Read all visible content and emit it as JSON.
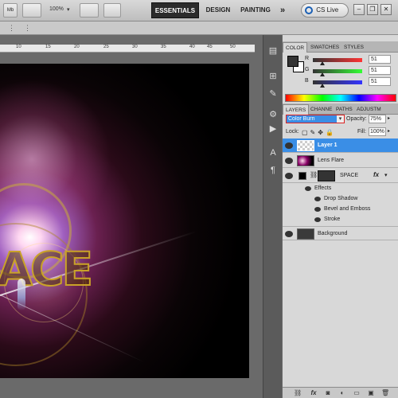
{
  "appbar": {
    "zoom": "100%",
    "workspaces": [
      "ESSENTIALS",
      "DESIGN",
      "PAINTING"
    ],
    "more": "»",
    "cs_live": "CS Live",
    "accent": "#1a5fb4"
  },
  "ruler": {
    "ticks": [
      "10",
      "15",
      "20",
      "25",
      "30",
      "35",
      "40",
      "45",
      "50"
    ]
  },
  "canvas": {
    "text": "ACE"
  },
  "color_panel": {
    "tabs": [
      "COLOR",
      "SWATCHES",
      "STYLES"
    ],
    "channels": [
      {
        "label": "R",
        "value": "51",
        "fraction": 0.2
      },
      {
        "label": "G",
        "value": "51",
        "fraction": 0.2
      },
      {
        "label": "B",
        "value": "51",
        "fraction": 0.2
      }
    ]
  },
  "layers_panel": {
    "tabs": [
      "LAYERS",
      "CHANNE",
      "PATHS",
      "ADJUSTM"
    ],
    "blend_mode": "Color Burn",
    "opacity_label": "Opacity:",
    "opacity": "75%",
    "lock_label": "Lock:",
    "fill_label": "Fill:",
    "fill": "100%",
    "layers": [
      {
        "name": "Layer 1",
        "selected": true
      },
      {
        "name": "Lens Flare",
        "selected": false
      },
      {
        "name": "SPACE",
        "selected": false,
        "fx": "fx"
      }
    ],
    "effects_label": "Effects",
    "effects": [
      "Drop Shadow",
      "Bevel and Emboss",
      "Stroke"
    ],
    "background": "Background"
  }
}
